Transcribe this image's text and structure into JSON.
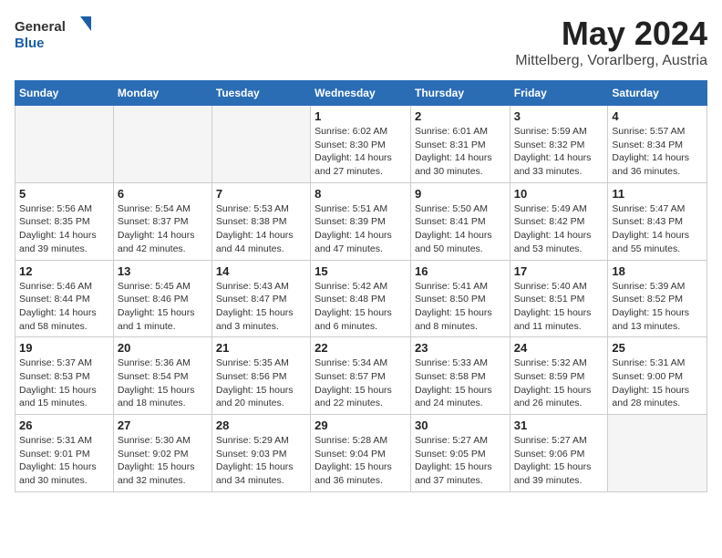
{
  "header": {
    "logo_general": "General",
    "logo_blue": "Blue",
    "main_title": "May 2024",
    "subtitle": "Mittelberg, Vorarlberg, Austria"
  },
  "weekdays": [
    "Sunday",
    "Monday",
    "Tuesday",
    "Wednesday",
    "Thursday",
    "Friday",
    "Saturday"
  ],
  "weeks": [
    [
      {
        "day": "",
        "info": ""
      },
      {
        "day": "",
        "info": ""
      },
      {
        "day": "",
        "info": ""
      },
      {
        "day": "1",
        "info": "Sunrise: 6:02 AM\nSunset: 8:30 PM\nDaylight: 14 hours\nand 27 minutes."
      },
      {
        "day": "2",
        "info": "Sunrise: 6:01 AM\nSunset: 8:31 PM\nDaylight: 14 hours\nand 30 minutes."
      },
      {
        "day": "3",
        "info": "Sunrise: 5:59 AM\nSunset: 8:32 PM\nDaylight: 14 hours\nand 33 minutes."
      },
      {
        "day": "4",
        "info": "Sunrise: 5:57 AM\nSunset: 8:34 PM\nDaylight: 14 hours\nand 36 minutes."
      }
    ],
    [
      {
        "day": "5",
        "info": "Sunrise: 5:56 AM\nSunset: 8:35 PM\nDaylight: 14 hours\nand 39 minutes."
      },
      {
        "day": "6",
        "info": "Sunrise: 5:54 AM\nSunset: 8:37 PM\nDaylight: 14 hours\nand 42 minutes."
      },
      {
        "day": "7",
        "info": "Sunrise: 5:53 AM\nSunset: 8:38 PM\nDaylight: 14 hours\nand 44 minutes."
      },
      {
        "day": "8",
        "info": "Sunrise: 5:51 AM\nSunset: 8:39 PM\nDaylight: 14 hours\nand 47 minutes."
      },
      {
        "day": "9",
        "info": "Sunrise: 5:50 AM\nSunset: 8:41 PM\nDaylight: 14 hours\nand 50 minutes."
      },
      {
        "day": "10",
        "info": "Sunrise: 5:49 AM\nSunset: 8:42 PM\nDaylight: 14 hours\nand 53 minutes."
      },
      {
        "day": "11",
        "info": "Sunrise: 5:47 AM\nSunset: 8:43 PM\nDaylight: 14 hours\nand 55 minutes."
      }
    ],
    [
      {
        "day": "12",
        "info": "Sunrise: 5:46 AM\nSunset: 8:44 PM\nDaylight: 14 hours\nand 58 minutes."
      },
      {
        "day": "13",
        "info": "Sunrise: 5:45 AM\nSunset: 8:46 PM\nDaylight: 15 hours\nand 1 minute."
      },
      {
        "day": "14",
        "info": "Sunrise: 5:43 AM\nSunset: 8:47 PM\nDaylight: 15 hours\nand 3 minutes."
      },
      {
        "day": "15",
        "info": "Sunrise: 5:42 AM\nSunset: 8:48 PM\nDaylight: 15 hours\nand 6 minutes."
      },
      {
        "day": "16",
        "info": "Sunrise: 5:41 AM\nSunset: 8:50 PM\nDaylight: 15 hours\nand 8 minutes."
      },
      {
        "day": "17",
        "info": "Sunrise: 5:40 AM\nSunset: 8:51 PM\nDaylight: 15 hours\nand 11 minutes."
      },
      {
        "day": "18",
        "info": "Sunrise: 5:39 AM\nSunset: 8:52 PM\nDaylight: 15 hours\nand 13 minutes."
      }
    ],
    [
      {
        "day": "19",
        "info": "Sunrise: 5:37 AM\nSunset: 8:53 PM\nDaylight: 15 hours\nand 15 minutes."
      },
      {
        "day": "20",
        "info": "Sunrise: 5:36 AM\nSunset: 8:54 PM\nDaylight: 15 hours\nand 18 minutes."
      },
      {
        "day": "21",
        "info": "Sunrise: 5:35 AM\nSunset: 8:56 PM\nDaylight: 15 hours\nand 20 minutes."
      },
      {
        "day": "22",
        "info": "Sunrise: 5:34 AM\nSunset: 8:57 PM\nDaylight: 15 hours\nand 22 minutes."
      },
      {
        "day": "23",
        "info": "Sunrise: 5:33 AM\nSunset: 8:58 PM\nDaylight: 15 hours\nand 24 minutes."
      },
      {
        "day": "24",
        "info": "Sunrise: 5:32 AM\nSunset: 8:59 PM\nDaylight: 15 hours\nand 26 minutes."
      },
      {
        "day": "25",
        "info": "Sunrise: 5:31 AM\nSunset: 9:00 PM\nDaylight: 15 hours\nand 28 minutes."
      }
    ],
    [
      {
        "day": "26",
        "info": "Sunrise: 5:31 AM\nSunset: 9:01 PM\nDaylight: 15 hours\nand 30 minutes."
      },
      {
        "day": "27",
        "info": "Sunrise: 5:30 AM\nSunset: 9:02 PM\nDaylight: 15 hours\nand 32 minutes."
      },
      {
        "day": "28",
        "info": "Sunrise: 5:29 AM\nSunset: 9:03 PM\nDaylight: 15 hours\nand 34 minutes."
      },
      {
        "day": "29",
        "info": "Sunrise: 5:28 AM\nSunset: 9:04 PM\nDaylight: 15 hours\nand 36 minutes."
      },
      {
        "day": "30",
        "info": "Sunrise: 5:27 AM\nSunset: 9:05 PM\nDaylight: 15 hours\nand 37 minutes."
      },
      {
        "day": "31",
        "info": "Sunrise: 5:27 AM\nSunset: 9:06 PM\nDaylight: 15 hours\nand 39 minutes."
      },
      {
        "day": "",
        "info": ""
      }
    ]
  ]
}
